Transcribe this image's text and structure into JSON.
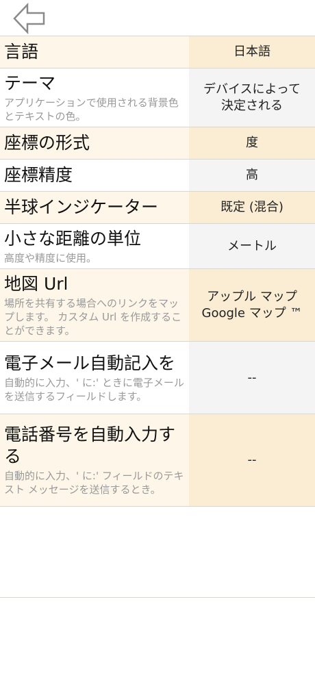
{
  "nav": {
    "back_icon": "arrow-left-icon"
  },
  "settings": [
    {
      "title": "言語",
      "desc": "",
      "value": "日本語"
    },
    {
      "title": "テーマ",
      "desc": "アプリケーションで使用される背景色とテキストの色。",
      "value": "デバイスによって\n決定される"
    },
    {
      "title": "座標の形式",
      "desc": "",
      "value": "度"
    },
    {
      "title": "座標精度",
      "desc": "",
      "value": "高"
    },
    {
      "title": "半球インジケーター",
      "desc": "",
      "value": "既定 (混合)"
    },
    {
      "title": "小さな距離の単位",
      "desc": "高度や精度に使用。",
      "value": "メートル"
    },
    {
      "title": "地図 Url",
      "desc": "場所を共有する場合へのリンクをマップします。 カスタム Url を作成することができます。",
      "value": "アップル マップ\nGoogle マップ ™"
    },
    {
      "title": "電子メール自動記入を",
      "desc": "自動的に入力、' に:' ときに電子メールを送信するフィールドします。",
      "value": "--"
    },
    {
      "title": "電話番号を自動入力する",
      "desc": "自動的に入力、' に:' フィールドのテキスト メッセージを送信するとき。",
      "value": "--"
    }
  ]
}
